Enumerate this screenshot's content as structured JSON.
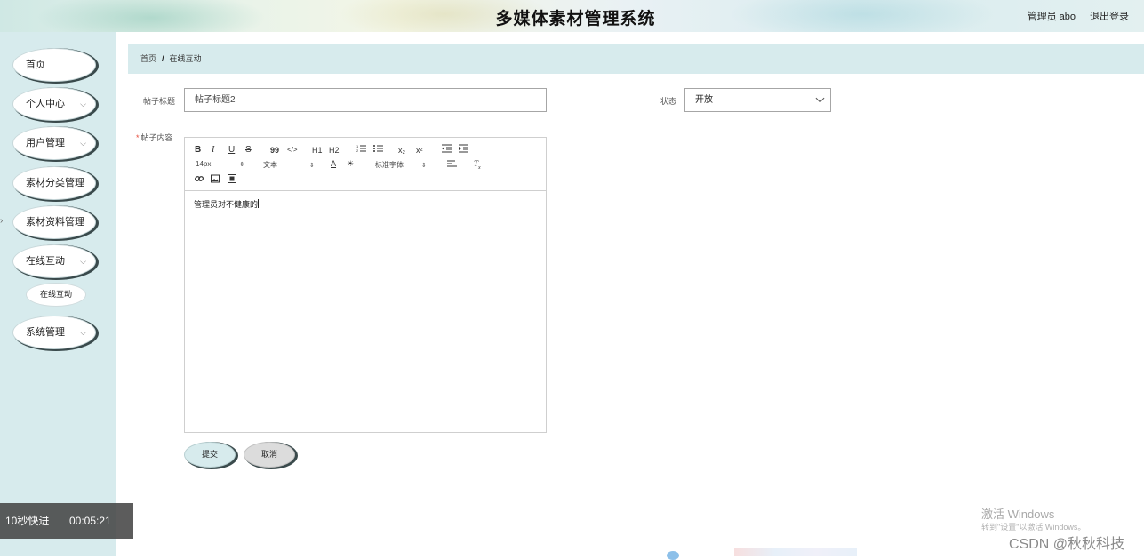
{
  "header": {
    "title": "多媒体素材管理系统",
    "user": "管理员 abo",
    "logout": "退出登录"
  },
  "sidebar": {
    "items": [
      {
        "label": "首页",
        "chevron": ""
      },
      {
        "label": "个人中心",
        "chevron": "⌵"
      },
      {
        "label": "用户管理",
        "chevron": "⌵"
      },
      {
        "label": "素材分类管理",
        "chevron": ""
      },
      {
        "label": "素材资料管理",
        "chevron": ""
      },
      {
        "label": "在线互动",
        "chevron": "⌵"
      },
      {
        "label": "系统管理",
        "chevron": "⌵"
      }
    ],
    "sub_item": "在线互动"
  },
  "breadcrumb": {
    "home": "首页",
    "separator": "/",
    "current": "在线互动"
  },
  "form": {
    "title_label": "帖子标题",
    "title_value": "帖子标题2",
    "status_label": "状态",
    "status_value": "开放",
    "content_required": "*",
    "content_label": "帖子内容",
    "content_value": "管理员对不健康的"
  },
  "toolbar": {
    "bold": "B",
    "italic": "I",
    "underline": "U",
    "strike": "S",
    "blockquote": "99",
    "code": "</>",
    "h1": "H1",
    "h2": "H2",
    "subscript": "x₂",
    "superscript": "x²",
    "font_size": "14px",
    "text_type": "文本",
    "font_family": "标准字体"
  },
  "buttons": {
    "submit": "提交",
    "cancel": "取消"
  },
  "overlay": {
    "label": "10秒快进",
    "time": "00:05:21"
  },
  "watermark": {
    "activate": "激活 Windows",
    "activate_sub": "转到\"设置\"以激活 Windows。",
    "csdn": "CSDN @秋秋科技"
  },
  "colors": {
    "sidebar_bg": "#d7ebed",
    "breadcrumb_bg": "#d7ebed",
    "required": "#e74c3c"
  }
}
